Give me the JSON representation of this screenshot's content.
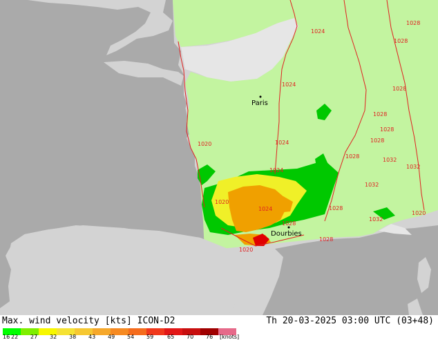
{
  "map": {
    "city_labels": [
      "Paris",
      "Dourbies"
    ],
    "isobar_labels": [
      "1024",
      "1024",
      "1024",
      "1024",
      "1020",
      "1020",
      "1020",
      "1024",
      "1028",
      "1028",
      "1028",
      "1028",
      "1028",
      "1028",
      "1028",
      "1032",
      "1032",
      "1032",
      "1032",
      "1028",
      "1028",
      "1028",
      "1020"
    ],
    "colors": {
      "sea": "#aaaaaa",
      "land_outside": "#d3d3d3",
      "land_outside_light": "#e6e6e6",
      "domain_land": "#c3f4a0",
      "isobar": "#e02020",
      "green": "#00c800",
      "yellow": "#f0f028",
      "orange": "#f0a000",
      "red": "#e00000"
    }
  },
  "footer": {
    "left_title": "Max. wind velocity [kts] ICON-D2",
    "right_title": "Th 20-03-2025 03:00 UTC (03+48)",
    "scale_labels": [
      "16",
      "22",
      "27",
      "32",
      "38",
      "43",
      "49",
      "54",
      "59",
      "65",
      "70",
      "76",
      "[knots]"
    ]
  },
  "legend": {
    "colors": [
      "#00ff00",
      "#7fef00",
      "#f7f700",
      "#f5e233",
      "#f6c832",
      "#f6a82b",
      "#f68a22",
      "#f56c1d",
      "#f0381c",
      "#e21717",
      "#c80f0f",
      "#a00000",
      "#e66a8a"
    ]
  }
}
